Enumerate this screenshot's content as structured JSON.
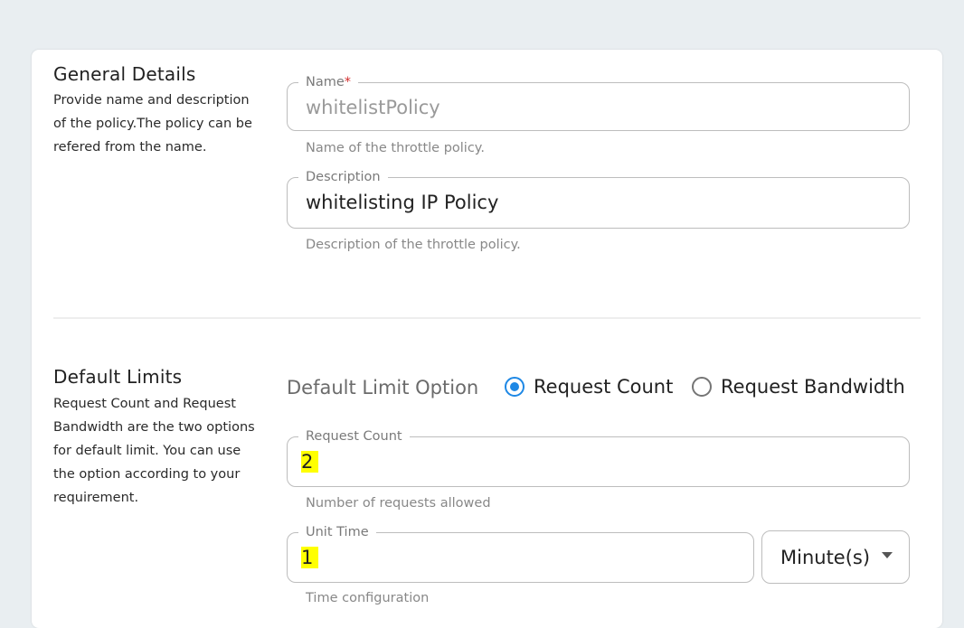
{
  "general": {
    "title": "General Details",
    "description": "Provide name and description of the policy.The policy can be refered from the name.",
    "name_field": {
      "label": "Name",
      "required_mark": "*",
      "value": "whitelistPolicy",
      "helper": "Name of the throttle policy."
    },
    "description_field": {
      "label": "Description",
      "value": "whitelisting IP Policy",
      "helper": "Description of the throttle policy."
    }
  },
  "limits": {
    "title": "Default Limits",
    "description": "Request Count and Request Bandwidth are the two options for default limit. You can use the option according to your requirement.",
    "option_label": "Default Limit Option",
    "options": [
      {
        "label": "Request Count",
        "selected": true
      },
      {
        "label": "Request Bandwidth",
        "selected": false
      }
    ],
    "request_count_field": {
      "label": "Request Count",
      "value": "2",
      "helper": "Number of requests allowed"
    },
    "unit_time_field": {
      "label": "Unit Time",
      "value": "1",
      "helper": "Time configuration"
    },
    "time_unit_select": {
      "value": "Minute(s)"
    }
  },
  "colors": {
    "accent": "#1e88e5",
    "highlight": "#ffff00",
    "required": "#d32f2f",
    "background": "#e9eef1"
  }
}
